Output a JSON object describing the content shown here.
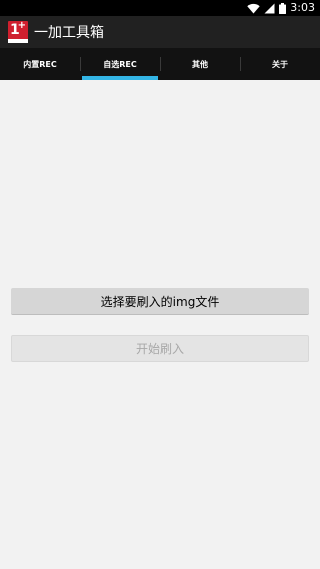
{
  "status_bar": {
    "time": "3:03",
    "icons": [
      "wifi-icon",
      "signal-icon",
      "battery-icon"
    ]
  },
  "action_bar": {
    "title": "一加工具箱",
    "logo_icon": "oneplus-logo-icon"
  },
  "tabs": [
    {
      "label": "内置REC",
      "active": false
    },
    {
      "label": "自选REC",
      "active": true
    },
    {
      "label": "其他",
      "active": false
    },
    {
      "label": "关于",
      "active": false
    }
  ],
  "main": {
    "select_image_button": "选择要刷入的img文件",
    "start_flash_button": "开始刷入"
  },
  "colors": {
    "status_bar": "#000000",
    "action_bar": "#212121",
    "tab_bar": "#121212",
    "tab_indicator": "#33b5e5",
    "logo_red": "#cf1f2e",
    "background": "#f2f2f2"
  }
}
